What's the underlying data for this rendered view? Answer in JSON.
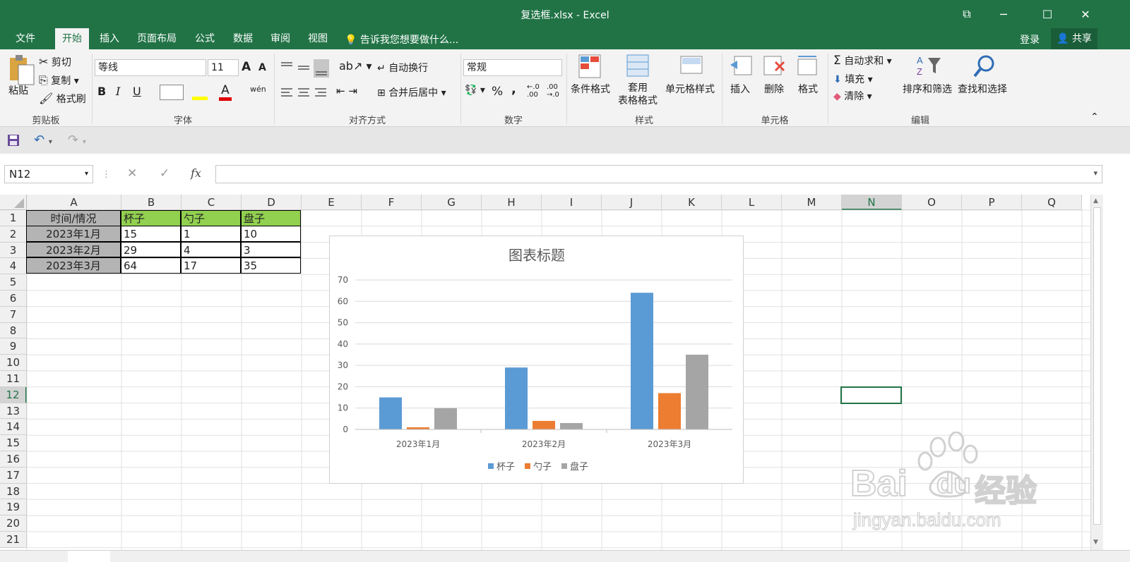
{
  "window": {
    "title": "复选框.xlsx - Excel",
    "controls": {
      "restore_ribbon": "⧉",
      "minimize": "─",
      "maximize": "☐",
      "close": "✕"
    }
  },
  "tabs": [
    "文件",
    "开始",
    "插入",
    "页面布局",
    "公式",
    "数据",
    "审阅",
    "视图"
  ],
  "tell_me": "告诉我您想要做什么...",
  "account": {
    "login": "登录",
    "share": "共享"
  },
  "ribbon": {
    "clipboard": {
      "paste": "粘贴",
      "cut": "剪切",
      "copy": "复制",
      "format_painter": "格式刷",
      "label": "剪贴板"
    },
    "font": {
      "name": "等线",
      "size": "11",
      "label": "字体",
      "bold": "B",
      "italic": "I",
      "underline": "U",
      "grow": "A",
      "shrink": "A",
      "font_color": "A",
      "phonetic": "wén"
    },
    "alignment": {
      "wrap": "自动换行",
      "merge": "合并后居中",
      "label": "对齐方式"
    },
    "number": {
      "format": "常规",
      "percent": "%",
      "comma": ",",
      "inc": "←.0\n.00",
      "dec": ".00\n→.0",
      "label": "数字"
    },
    "styles": {
      "conditional": "条件格式",
      "table": "套用\n表格格式",
      "cell_styles": "单元格样式",
      "label": "样式"
    },
    "cells": {
      "insert": "插入",
      "delete": "删除",
      "format": "格式",
      "label": "单元格"
    },
    "editing": {
      "autosum": "自动求和",
      "fill": "填充",
      "clear": "清除",
      "sort": "排序和筛选",
      "find": "查找和选择",
      "label": "编辑"
    }
  },
  "formula_bar": {
    "name_box": "N12",
    "fx": "fx",
    "cancel": "✕",
    "enter": "✓"
  },
  "columns": [
    "A",
    "B",
    "C",
    "D",
    "E",
    "F",
    "G",
    "H",
    "I",
    "J",
    "K",
    "L",
    "M",
    "N",
    "O",
    "P",
    "Q"
  ],
  "rows": [
    "1",
    "2",
    "3",
    "4",
    "5",
    "6",
    "7",
    "8",
    "9",
    "10",
    "11",
    "12",
    "13",
    "14",
    "15",
    "16",
    "17",
    "18",
    "19",
    "20",
    "21"
  ],
  "table": {
    "header": [
      "时间/情况",
      "杯子",
      "勺子",
      "盘子"
    ],
    "rows": [
      [
        "2023年1月",
        "15",
        "1",
        "10"
      ],
      [
        "2023年2月",
        "29",
        "4",
        "3"
      ],
      [
        "2023年3月",
        "64",
        "17",
        "35"
      ]
    ]
  },
  "colors": {
    "excel_green": "#217346",
    "series": [
      "#5b9bd5",
      "#ed7d31",
      "#a5a5a5"
    ],
    "header_fill": "#b4b4b4",
    "green_fill": "#92d050"
  },
  "chart_data": {
    "type": "bar",
    "title": "图表标题",
    "categories": [
      "2023年1月",
      "2023年2月",
      "2023年3月"
    ],
    "series": [
      {
        "name": "杯子",
        "values": [
          15,
          29,
          64
        ]
      },
      {
        "name": "勺子",
        "values": [
          1,
          4,
          17
        ]
      },
      {
        "name": "盘子",
        "values": [
          10,
          3,
          35
        ]
      }
    ],
    "ylim": [
      0,
      70
    ],
    "yticks": [
      0,
      10,
      20,
      30,
      40,
      50,
      60,
      70
    ],
    "grid": true,
    "legend": "bottom"
  },
  "watermark": {
    "brand": "Bai",
    "brand2": "du",
    "cn": "经验",
    "url": "jingyan.baidu.com"
  }
}
